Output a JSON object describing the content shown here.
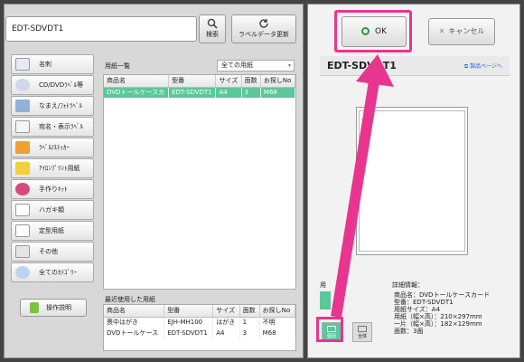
{
  "search": {
    "value": "EDT-SDVDT1",
    "search_label": "検索",
    "update_label": "ラベルデータ更新"
  },
  "categories": [
    "名刺",
    "CD/DVDﾗﾍﾞﾙ等",
    "なまえ/ﾌｫﾄﾗﾍﾞﾙ",
    "宛名・表示ﾗﾍﾞﾙ",
    "ﾗﾍﾞﾙ/ｽﾃｯｶｰ",
    "ｱｲﾛﾝﾌﾟﾘﾝﾄ用紙",
    "手作りｷｯﾄ",
    "ハガキ類",
    "定型用紙",
    "その他",
    "全てのｶﾃｺﾞﾘｰ"
  ],
  "help_label": "操作説明",
  "paper_list": {
    "title": "用紙一覧",
    "filter": "全ての用紙",
    "headers": [
      "商品名",
      "型番",
      "サイズ",
      "面数",
      "お探しNo"
    ],
    "rows": [
      [
        "DVDトールケースカ",
        "EDT-SDVDT1",
        "A4",
        "3",
        "M68"
      ]
    ]
  },
  "recent_list": {
    "title": "最近使用した用紙",
    "headers": [
      "商品名",
      "型番",
      "サイズ",
      "面数",
      "お探しNo"
    ],
    "rows": [
      [
        "喪中はがき",
        "EJH-MH100",
        "はがき",
        "1",
        "不明"
      ],
      [
        "DVDトールケース",
        "EDT-SDVDT1",
        "A4",
        "3",
        "M68"
      ]
    ]
  },
  "right": {
    "ok_label": "OK",
    "cancel_label": "キャンセル",
    "product_title": "EDT-SDVDT1",
    "product_link": "製品ページへ",
    "side_label": "用",
    "view_single": "個別",
    "view_all": "全体",
    "detail_title": "詳細情報：",
    "detail_lines": [
      "商品名：DVDトールケースカード",
      "型番：EDT-SDVDT1",
      "用紙サイズ：A4",
      "用紙（幅×高）：210×297mm",
      "一片（幅×高）：182×129mm",
      "面数：3面"
    ]
  },
  "colors": {
    "selection": "#5bc79a",
    "highlight": "#e8358f"
  }
}
